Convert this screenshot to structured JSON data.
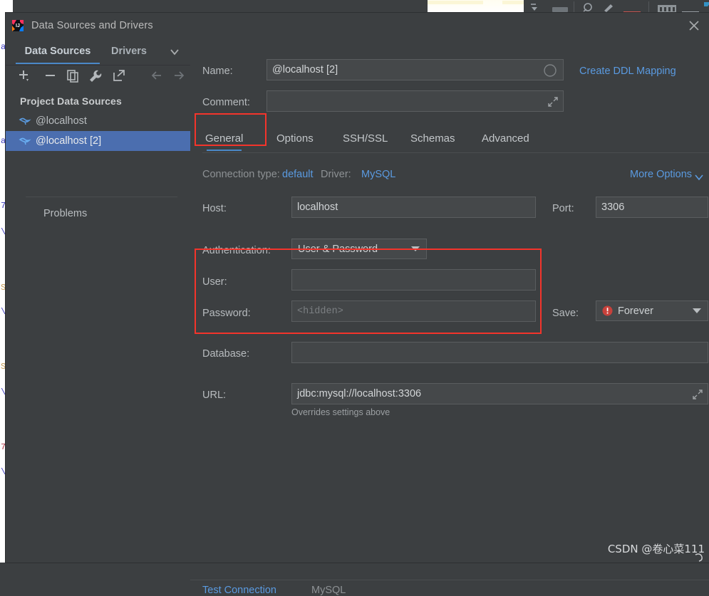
{
  "window": {
    "title": "Data Sources and Drivers",
    "app_icon": "intellij-idea-logo",
    "close_icon": "close-icon"
  },
  "sidebar": {
    "tabs": [
      {
        "label": "Data Sources",
        "active": true
      },
      {
        "label": "Drivers",
        "active": false
      }
    ],
    "tabs_overflow_icon": "chevron-down-icon",
    "toolbar": [
      {
        "name": "add-data-source-button",
        "icon": "plus-icon"
      },
      {
        "name": "remove-data-source-button",
        "icon": "minus-icon"
      },
      {
        "name": "duplicate-data-source-button",
        "icon": "copy-icon"
      },
      {
        "name": "properties-button",
        "icon": "wrench-icon"
      },
      {
        "name": "export-button",
        "icon": "external-link-icon"
      },
      {
        "name": "back-button",
        "icon": "arrow-left-icon"
      },
      {
        "name": "forward-button",
        "icon": "arrow-right-icon"
      }
    ],
    "tree_header": "Project Data Sources",
    "tree_items": [
      {
        "label": "@localhost",
        "icon": "mysql-dolphin-icon",
        "selected": false
      },
      {
        "label": "@localhost [2]",
        "icon": "mysql-dolphin-icon",
        "selected": true
      }
    ],
    "problems_label": "Problems"
  },
  "form": {
    "name_label": "Name:",
    "name_value": "@localhost [2]",
    "name_status_icon": "circle-icon",
    "create_ddl_mapping": "Create DDL Mapping",
    "comment_label": "Comment:",
    "comment_value": "",
    "comment_expand_icon": "expand-icon",
    "tabs": [
      {
        "label": "General",
        "active": true
      },
      {
        "label": "Options",
        "active": false
      },
      {
        "label": "SSH/SSL",
        "active": false
      },
      {
        "label": "Schemas",
        "active": false
      },
      {
        "label": "Advanced",
        "active": false
      }
    ],
    "connection_type_label": "Connection type:",
    "connection_type_value": "default",
    "driver_label": "Driver:",
    "driver_value": "MySQL",
    "more_options": "More Options",
    "more_options_icon": "chevron-down-icon",
    "host_label": "Host:",
    "host_value": "localhost",
    "port_label": "Port:",
    "port_value": "3306",
    "authentication_label": "Authentication:",
    "authentication_value": "User & Password",
    "authentication_caret_icon": "caret-down-icon",
    "user_label": "User:",
    "user_value": "",
    "password_label": "Password:",
    "password_placeholder": "<hidden>",
    "save_label": "Save:",
    "save_value": "Forever",
    "save_icon": "warning-circle-icon",
    "save_caret_icon": "caret-down-icon",
    "database_label": "Database:",
    "database_value": "",
    "url_label": "URL:",
    "url_value": "jdbc:mysql://localhost:3306",
    "url_expand_icon": "expand-icon",
    "url_hint": "Overrides settings above"
  },
  "footer": {
    "test_connection": "Test Connection",
    "driver_status": "MySQL"
  },
  "annotations": {
    "highlight_color": "#f4342b",
    "boxes": [
      {
        "name": "general-tab-highlight"
      },
      {
        "name": "credentials-highlight"
      }
    ]
  },
  "watermark": {
    "text": "CSDN @卷心菜111",
    "glyph": "undo-arrow-icon"
  },
  "colors": {
    "accent_blue": "#4a88c7",
    "link_blue": "#5a9ae0",
    "selection_blue": "#4b6eaf",
    "panel_bg": "#3c3f41",
    "field_bg": "#45484a",
    "red": "#f4342b"
  }
}
